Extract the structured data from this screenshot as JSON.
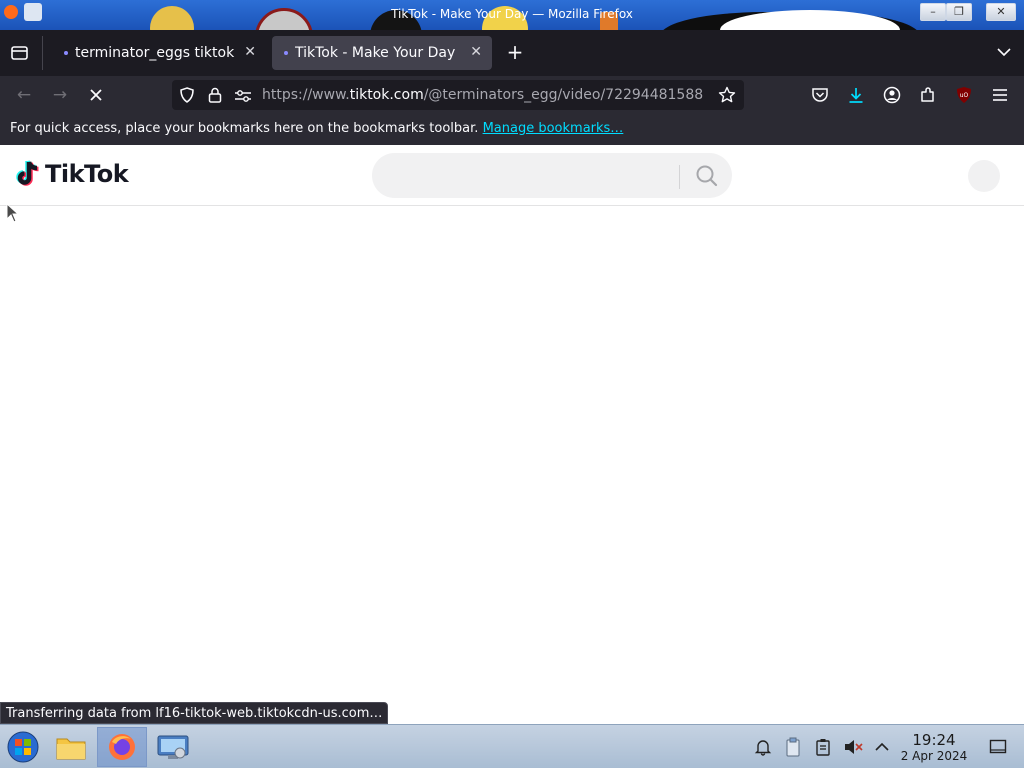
{
  "window": {
    "title": "TikTok - Make Your Day — Mozilla Firefox"
  },
  "tabs": [
    {
      "label": "terminator_eggs tiktok -",
      "active": false
    },
    {
      "label": "TikTok - Make Your Day",
      "active": true
    }
  ],
  "navbar": {
    "url_prefix": "https://www.",
    "url_host": "tiktok.com",
    "url_path": "/@terminators_egg/video/72294481588",
    "loading": true
  },
  "bookmarks_bar": {
    "message": "For quick access, place your bookmarks here on the bookmarks toolbar.",
    "link": "Manage bookmarks…"
  },
  "tiktok": {
    "logo_text": "TikTok",
    "search_placeholder": ""
  },
  "status": {
    "text": "Transferring data from lf16-tiktok-web.tiktokcdn-us.com…"
  },
  "taskbar": {
    "time": "19:24",
    "date": "2 Apr 2024"
  },
  "colors": {
    "accent": "#00ddff",
    "tab_dot": "#8a8aff"
  }
}
